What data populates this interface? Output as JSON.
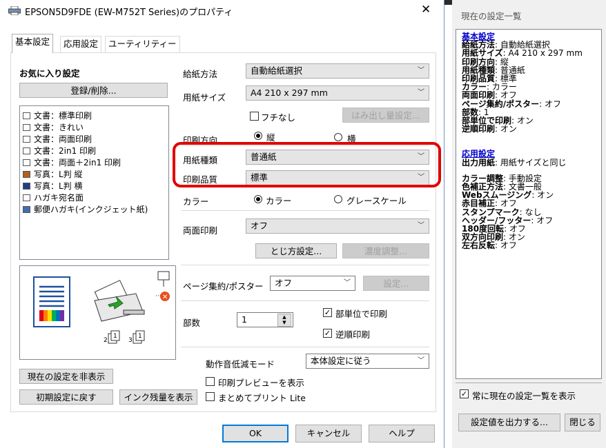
{
  "window": {
    "title": "EPSON5D9FDE (EW-M752T Series)のプロパティ",
    "close": "✕"
  },
  "tabs": [
    "基本設定",
    "応用設定",
    "ユーティリティー"
  ],
  "favorites": {
    "title": "お気に入り設定",
    "register_button": "登録/削除...",
    "items": [
      "文書：標準印刷",
      "文書：きれい",
      "文書：両面印刷",
      "文書：2in1 印刷",
      "文書：両面＋2in1 印刷",
      "写真：L判 縦",
      "写真：L判 横",
      "ハガキ宛名面",
      "郵便ハガキ(インクジェット紙)"
    ]
  },
  "settings": {
    "paper_source_label": "給紙方法",
    "paper_source_value": "自動給紙選択",
    "paper_size_label": "用紙サイズ",
    "paper_size_value": "A4 210 x 297 mm",
    "borderless_label": "フチなし",
    "overflow_button": "はみ出し量設定...",
    "orientation_label": "印刷方向",
    "orientation_portrait": "縦",
    "orientation_landscape": "横",
    "paper_type_label": "用紙種類",
    "paper_type_value": "普通紙",
    "quality_label": "印刷品質",
    "quality_value": "標準",
    "color_label": "カラー",
    "color_option": "カラー",
    "grayscale_option": "グレースケール",
    "duplex_label": "両面印刷",
    "duplex_value": "オフ",
    "binding_button": "とじ方設定...",
    "density_button": "濃度調整...",
    "multipage_label": "ページ集約/ポスター",
    "multipage_value": "オフ",
    "multipage_settings_button": "設定...",
    "copies_label": "部数",
    "copies_value": "1",
    "collate_label": "部単位で印刷",
    "reverse_label": "逆順印刷",
    "quiet_mode_label": "動作音低減モード",
    "quiet_mode_value": "本体設定に従う",
    "print_preview_label": "印刷プレビューを表示",
    "jobarranger_label": "まとめてプリント Lite"
  },
  "bottom_buttons": {
    "hide_current": "現在の設定を非表示",
    "reset": "初期設定に戻す",
    "ink_levels": "インク残量を表示",
    "ok": "OK",
    "cancel": "キャンセル",
    "help": "ヘルプ"
  },
  "current_settings": {
    "title": "現在の設定一覧",
    "basic_heading": "基本設定",
    "basic": [
      [
        "給紙方法",
        ": 自動給紙選択"
      ],
      [
        "用紙サイズ",
        ": A4 210 x 297 mm"
      ],
      [
        "印刷方向",
        ": 縦"
      ],
      [
        "用紙種類",
        ": 普通紙"
      ],
      [
        "印刷品質",
        ": 標準"
      ],
      [
        "カラー",
        ": カラー"
      ],
      [
        "両面印刷",
        ": オフ"
      ],
      [
        "ページ集約/ポスター",
        ": オフ"
      ],
      [
        "部数",
        ": 1"
      ],
      [
        "部単位で印刷",
        ": オン"
      ],
      [
        "逆順印刷",
        ": オン"
      ]
    ],
    "advanced_heading": "応用設定",
    "advanced_first": [
      "出力用紙",
      ": 用紙サイズと同じ"
    ],
    "advanced": [
      [
        "カラー調整",
        ": 手動設定"
      ],
      [
        "色補正方法",
        ": 文書一般"
      ],
      [
        "Webスムージング",
        ": オン"
      ],
      [
        "赤目補正",
        ": オフ"
      ],
      [
        "スタンプマーク",
        ": なし"
      ],
      [
        "ヘッダー/フッター",
        ": オフ"
      ],
      [
        "180度回転",
        ": オフ"
      ],
      [
        "双方向印刷",
        ": オン"
      ],
      [
        "左右反転",
        ": オフ"
      ]
    ],
    "always_show_label": "常に現在の設定一覧を表示",
    "export_button": "設定値を出力する...",
    "close_button": "閉じる"
  }
}
